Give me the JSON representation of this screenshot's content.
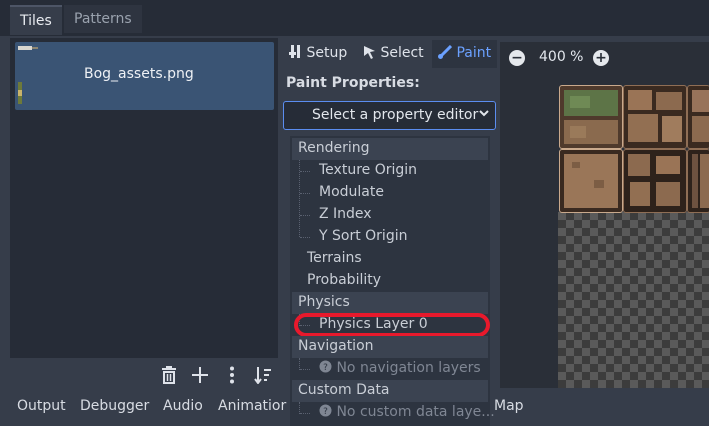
{
  "top_tabs": [
    {
      "label": "Tiles",
      "active": true
    },
    {
      "label": "Patterns",
      "active": false
    }
  ],
  "tile_sources": {
    "items": [
      {
        "label": "Bog_assets.png"
      }
    ]
  },
  "left_toolbar": {
    "icons": [
      "trash-icon",
      "plus-icon",
      "kebab-menu-icon",
      "sort-icon"
    ]
  },
  "modes": {
    "setup": "Setup",
    "select": "Select",
    "paint": "Paint",
    "active": "Paint"
  },
  "paint_properties": {
    "heading": "Paint Properties:",
    "selector": "Select a property editor"
  },
  "property_tree": {
    "rendering": {
      "label": "Rendering",
      "items": [
        "Texture Origin",
        "Modulate",
        "Z Index",
        "Y Sort Origin"
      ]
    },
    "terrains": "Terrains",
    "probability": "Probability",
    "physics": {
      "label": "Physics",
      "items": [
        "Physics Layer 0"
      ]
    },
    "navigation": {
      "label": "Navigation",
      "empty": "No navigation layers"
    },
    "custom_data": {
      "label": "Custom Data",
      "empty": "No custom data laye..."
    }
  },
  "canvas": {
    "zoom": "400 %"
  },
  "bottom_panel": {
    "tabs": [
      "Output",
      "Debugger",
      "Audio",
      "Animatior",
      "Map"
    ]
  },
  "colors": {
    "accent": "#6ba1ff",
    "highlight_annotation": "#e8192c",
    "selected_item": "#3a5474"
  }
}
